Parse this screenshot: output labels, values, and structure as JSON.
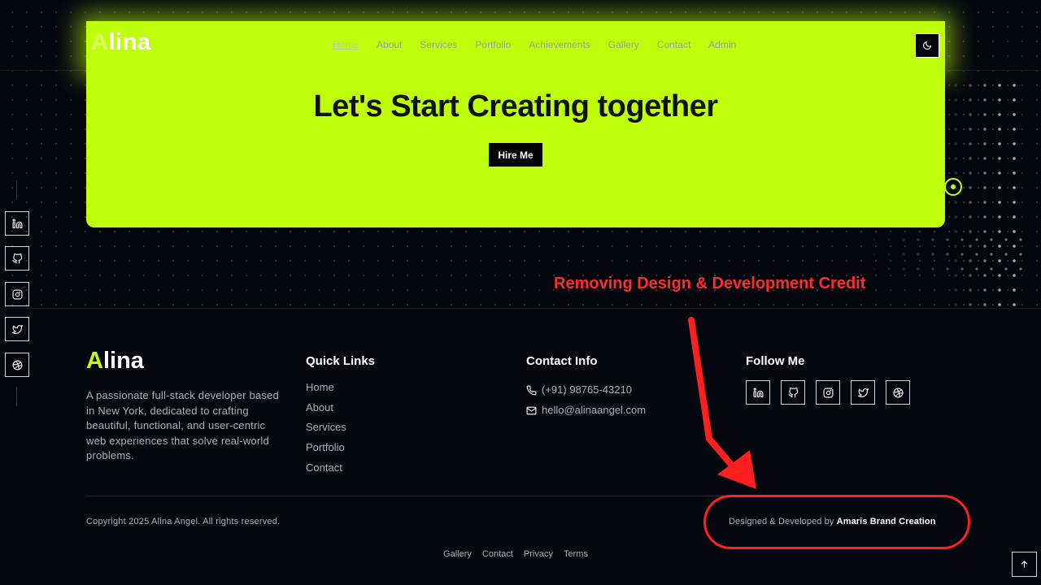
{
  "header": {
    "brand_initial": "A",
    "brand_rest": "lina",
    "nav": [
      "Home",
      "About",
      "Services",
      "Portfolio",
      "Achievements",
      "Gallery",
      "Contact",
      "Admin"
    ],
    "active_nav": "Home",
    "theme_toggle_icon": "moon-icon"
  },
  "cta": {
    "title": "Let's Start Creating together",
    "button": "Hire Me"
  },
  "annotation": {
    "text": "Removing Design & Development Credit"
  },
  "side_social": [
    "linkedin-icon",
    "github-icon",
    "instagram-icon",
    "twitter-icon",
    "dribbble-icon"
  ],
  "footer": {
    "brand_initial": "A",
    "brand_rest": "lina",
    "about": "A passionate full-stack developer based in New York, dedicated to crafting beautiful, functional, and user-centric web experiences that solve real-world problems.",
    "quick_links_title": "Quick Links",
    "quick_links": [
      "Home",
      "About",
      "Services",
      "Portfolio",
      "Contact"
    ],
    "contact_title": "Contact Info",
    "phone": "(+91) 98765-43210",
    "email": "hello@alinaangel.com",
    "follow_title": "Follow Me",
    "copyright": "Copyright 2025 Alina Angel. All rights reserved.",
    "credit_prefix": "Designed & Developed by",
    "credit_name": "Amaris Brand Creation",
    "bottom_links": [
      "Gallery",
      "Contact",
      "Privacy",
      "Terms"
    ]
  },
  "colors": {
    "accent": "#c0ff0a",
    "background": "#05070f",
    "annotation": "#ff2d2d"
  }
}
